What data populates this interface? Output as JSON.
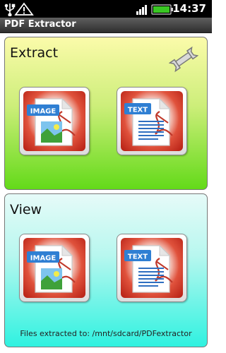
{
  "status_bar": {
    "time": "14:37",
    "icons": [
      "usb-icon",
      "warning-icon",
      "signal-icon",
      "battery-icon"
    ]
  },
  "app": {
    "title": "PDF Extractor"
  },
  "extract": {
    "title": "Extract",
    "settings_icon": "wrench-icon",
    "image_tile_label": "IMAGE",
    "text_tile_label": "TEXT"
  },
  "view": {
    "title": "View",
    "image_tile_label": "IMAGE",
    "text_tile_label": "TEXT",
    "footer": "Files extracted to: /mnt/sdcard/PDFextractor"
  },
  "colors": {
    "extract_panel_top": "#fbfbaa",
    "extract_panel_bottom": "#63da19",
    "view_panel_top": "#e6fbf8",
    "view_panel_bottom": "#2ff2e0",
    "tile_red": "#c8281a",
    "label_blue": "#2f7fd3",
    "battery_green": "#39c623"
  }
}
